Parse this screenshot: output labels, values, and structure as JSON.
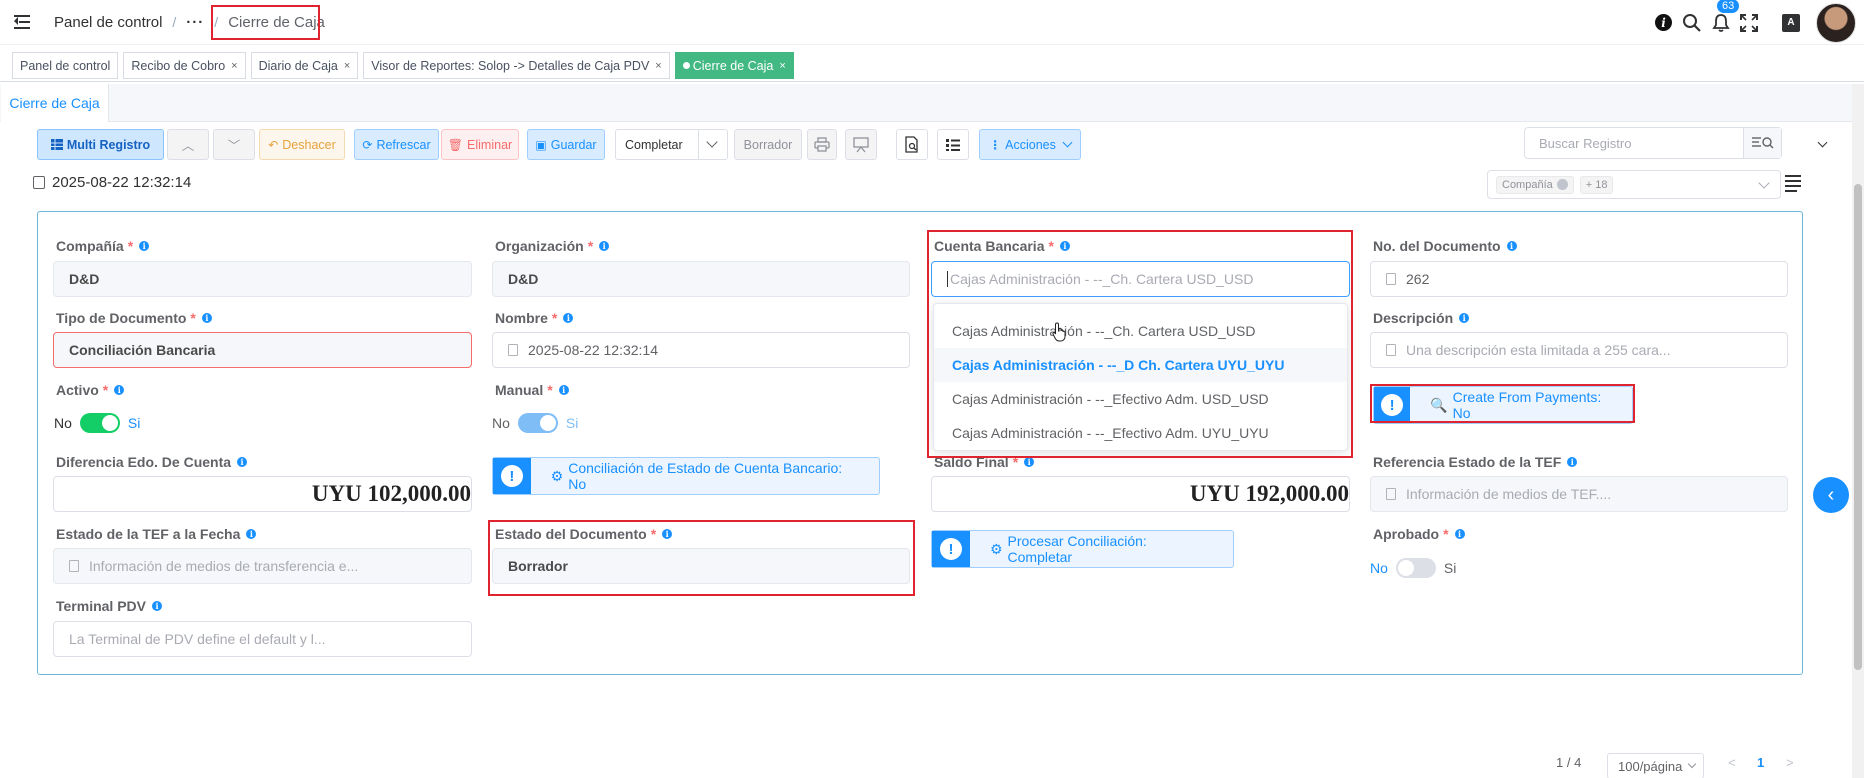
{
  "header": {
    "breadcrumb_root": "Panel de control",
    "breadcrumb_sep": "/",
    "breadcrumb_more": "···",
    "breadcrumb_current": "Cierre de Caja",
    "notifications_count": "63",
    "lang_icon_text": "A"
  },
  "tabs": [
    {
      "label": "Panel de control",
      "closable": false
    },
    {
      "label": "Recibo de Cobro",
      "closable": true
    },
    {
      "label": "Diario de Caja",
      "closable": true
    },
    {
      "label": "Visor de Reportes: Solop -> Detalles de Caja PDV",
      "closable": true
    },
    {
      "label": "Cierre de Caja",
      "closable": true,
      "active": true
    }
  ],
  "tab_close": "×",
  "panel_tab": "Cierre de Caja",
  "toolbar": {
    "multi_record": "Multi Registro",
    "undo": "Deshacer",
    "refresh": "Refrescar",
    "delete": "Eliminar",
    "save": "Guardar",
    "complete": "Completar",
    "draft": "Borrador",
    "actions": "Acciones",
    "search_placeholder": "Buscar Registro"
  },
  "record_date": "2025-08-22 12:32:14",
  "filter": {
    "chip": "Compañía",
    "more": "+ 18"
  },
  "form": {
    "company_label": "Compañía",
    "company_value": "D&D",
    "org_label": "Organización",
    "org_value": "D&D",
    "bank_account_label": "Cuenta Bancaria",
    "bank_account_placeholder": "Cajas Administración - --_Ch. Cartera USD_USD",
    "doc_no_label": "No. del Documento",
    "doc_no_value": "262",
    "doc_type_label": "Tipo de Documento",
    "doc_type_value": "Conciliación Bancaria",
    "name_label": "Nombre",
    "name_value": "2025-08-22 12:32:14",
    "description_label": "Descripción",
    "description_placeholder": "Una descripción esta limitada a 255 cara...",
    "active_label": "Activo",
    "manual_label": "Manual",
    "no": "No",
    "yes": "Si",
    "create_from_payments": "Create From Payments: No",
    "statement_diff_label": "Diferencia Edo. De Cuenta",
    "statement_diff_value": "UYU 102,000.00",
    "reconcile_btn": "Conciliación de Estado de Cuenta Bancario: No",
    "ending_balance_label": "Saldo Final",
    "ending_balance_value": "UYU 192,000.00",
    "eft_ref_label": "Referencia Estado de la TEF",
    "eft_ref_placeholder": "Información de medios de TEF....",
    "eft_date_label": "Estado de la TEF a la Fecha",
    "eft_date_placeholder": "Información de medios de transferencia e...",
    "doc_status_label": "Estado del Documento",
    "doc_status_value": "Borrador",
    "process_btn": "Procesar Conciliación: Completar",
    "approved_label": "Aprobado",
    "pos_label": "Terminal PDV",
    "pos_placeholder": "La Terminal de PDV define el default y l..."
  },
  "dropdown_options": [
    {
      "label": "Cajas Administración - --_Ch. Cartera USD_USD",
      "selected": false
    },
    {
      "label": "Cajas Administración - --_D Ch. Cartera UYU_UYU",
      "selected": true
    },
    {
      "label": "Cajas Administración - --_Efectivo Adm. USD_USD",
      "selected": false
    },
    {
      "label": "Cajas Administración - --_Efectivo Adm. UYU_UYU",
      "selected": false
    }
  ],
  "pagination": {
    "records": "1 / 4",
    "page_size": "100/página",
    "current_page": "1",
    "prev": "<",
    "next": ">"
  },
  "colors": {
    "accent": "#1890ff",
    "active_tab": "#42b983",
    "switch_on": "#13ce66",
    "switch_on_light": "#7fbdf7",
    "highlight": "#e0242f"
  }
}
